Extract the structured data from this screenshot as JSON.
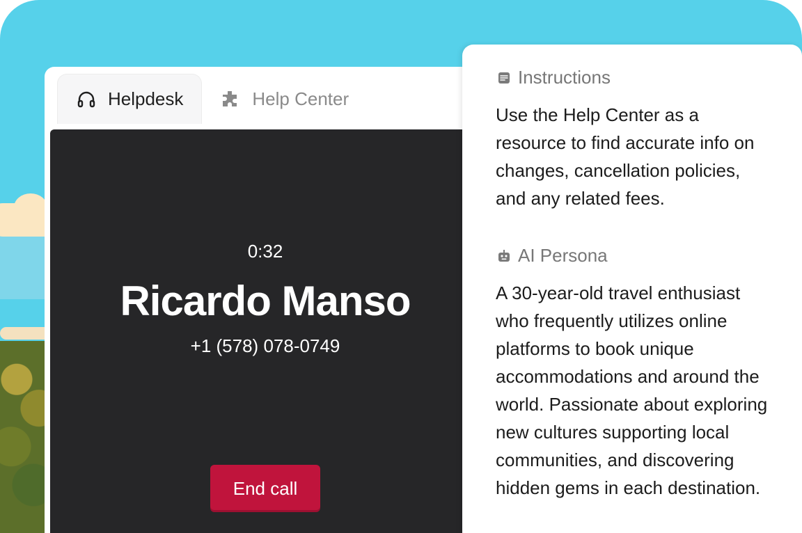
{
  "tabs": [
    {
      "label": "Helpdesk",
      "icon": "headset-icon",
      "active": true
    },
    {
      "label": "Help Center",
      "icon": "puzzle-icon",
      "active": false
    }
  ],
  "call": {
    "timer": "0:32",
    "caller_name": "Ricardo Manso",
    "caller_phone": "+1 (578) 078-0749",
    "end_call_label": "End call",
    "end_call_color": "#c0143c"
  },
  "sidebar": {
    "instructions": {
      "title": "Instructions",
      "icon": "note-icon",
      "body": "Use the Help Center as a resource to find accurate info on changes, cancellation policies, and any related fees."
    },
    "persona": {
      "title": "AI Persona",
      "icon": "robot-icon",
      "body": "A 30-year-old travel enthusiast who frequently utilizes online platforms to book unique accommodations and around the world. Passionate about exploring new cultures supporting local communities, and discovering hidden gems in each destination."
    }
  }
}
